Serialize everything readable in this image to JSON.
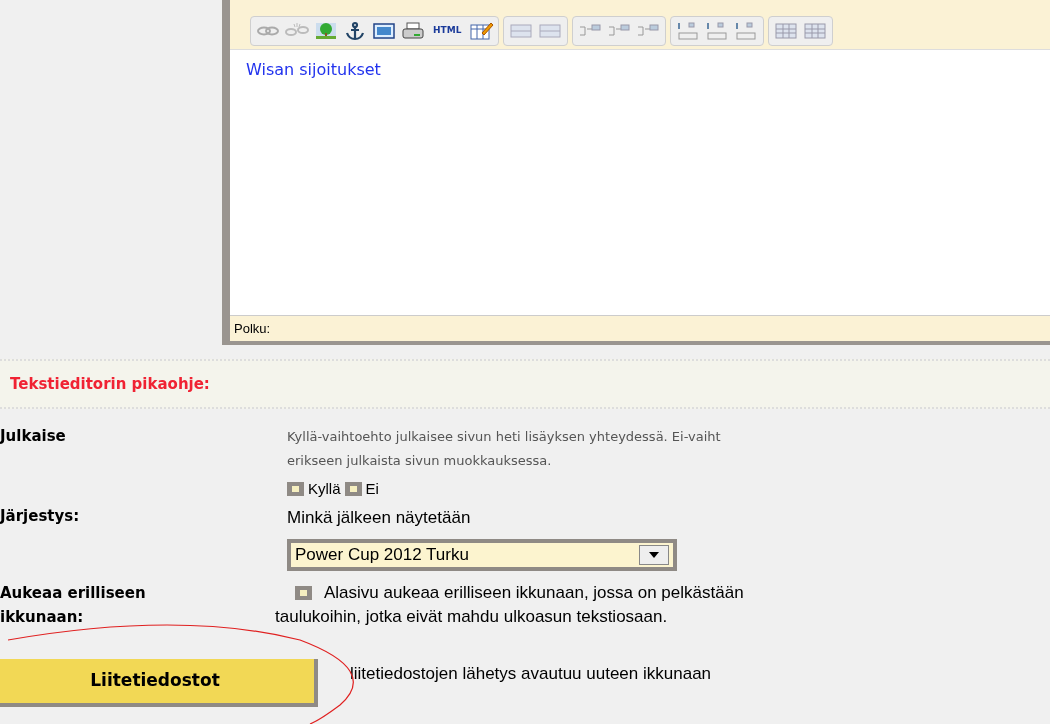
{
  "editor": {
    "toolbar_groups": [
      {
        "items": [
          {
            "kind": "link"
          },
          {
            "kind": "unlink"
          },
          {
            "kind": "image"
          },
          {
            "kind": "anchor"
          },
          {
            "kind": "media"
          },
          {
            "kind": "print"
          },
          {
            "kind": "text",
            "label": "HTML"
          },
          {
            "kind": "edit"
          }
        ]
      },
      {
        "items": [
          {
            "kind": "row"
          },
          {
            "kind": "row"
          }
        ]
      },
      {
        "items": [
          {
            "kind": "indent"
          },
          {
            "kind": "indent"
          },
          {
            "kind": "indent"
          }
        ]
      },
      {
        "items": [
          {
            "kind": "column"
          },
          {
            "kind": "column"
          },
          {
            "kind": "column"
          }
        ]
      },
      {
        "items": [
          {
            "kind": "table"
          },
          {
            "kind": "table"
          }
        ]
      }
    ],
    "content": "Wisan sijoitukset",
    "path_label": "Polku:"
  },
  "help": {
    "title": "Tekstieditorin pikaohje:"
  },
  "fields": [
    {
      "kind": "publish",
      "label": "Julkaise",
      "description": "Kyllä-vaihtoehto julkaisee sivun heti lisäyksen yhteydessä. Ei-vaiht",
      "description_2": "erikseen julkaista sivun muokkauksessa.",
      "options": [
        {
          "label": "Kyllä",
          "checked": true
        },
        {
          "label": "Ei",
          "checked": true
        }
      ]
    },
    {
      "kind": "order",
      "label": "Järjestys:",
      "description": "Minkä jälkeen näytetään",
      "select": "Power Cup 2012 Turku"
    },
    {
      "kind": "window",
      "label": "Aukeaa erilliseen",
      "label_2": "ikkunaan:",
      "checked": true,
      "description": "Alasivu aukeaa erilliseen ikkunaan, jossa on pelkästään",
      "description_2": "taulukoihin, jotka eivät mahdu ulkoasun tekstiosaan."
    }
  ],
  "attachments": {
    "button": "Liitetiedostot",
    "note": "liitetiedostojen lähetys avautuu uuteen ikkunaan"
  }
}
